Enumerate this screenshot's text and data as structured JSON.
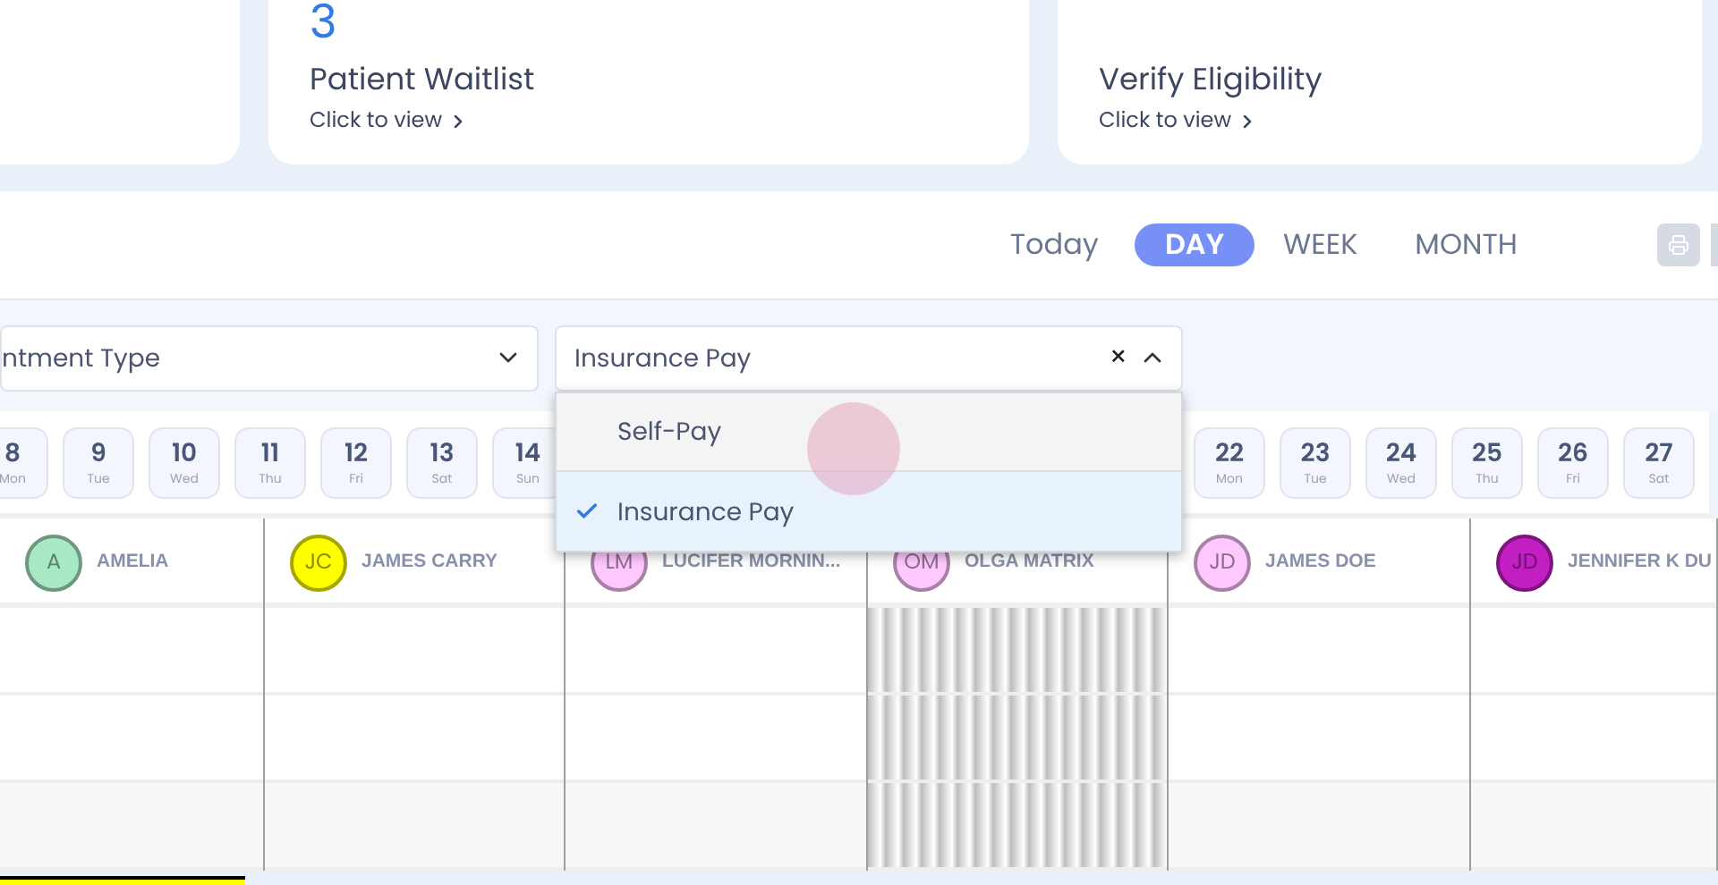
{
  "summary_cards": [
    {
      "count": "3",
      "title": "Patient Waitlist",
      "link": "Click to view"
    },
    {
      "title": "Verify Eligibility",
      "link": "Click to view"
    }
  ],
  "view_tabs": [
    {
      "label": "Today",
      "selected": false,
      "kind": "link"
    },
    {
      "label": "DAY",
      "selected": true,
      "kind": "tab"
    },
    {
      "label": "WEEK",
      "selected": false,
      "kind": "tab"
    },
    {
      "label": "MONTH",
      "selected": false,
      "kind": "tab"
    }
  ],
  "filters": [
    {
      "value": "ntment Type",
      "open": false
    },
    {
      "value": "Insurance Pay",
      "open": true,
      "clear": "×"
    }
  ],
  "dropdown": {
    "options": [
      {
        "label": "Self-Pay",
        "selected": false
      },
      {
        "label": "Insurance Pay",
        "selected": true
      }
    ]
  },
  "days_before": [
    {
      "day": "8",
      "weekday": "Mon"
    },
    {
      "day": "9",
      "weekday": "Tue"
    },
    {
      "day": "10",
      "weekday": "Wed"
    },
    {
      "day": "11",
      "weekday": "Thu"
    },
    {
      "day": "12",
      "weekday": "Fri"
    },
    {
      "day": "13",
      "weekday": "Sat"
    },
    {
      "day": "14",
      "weekday": "Sun"
    }
  ],
  "days_after": [
    {
      "day": "22",
      "weekday": "Mon"
    },
    {
      "day": "23",
      "weekday": "Tue"
    },
    {
      "day": "24",
      "weekday": "Wed"
    },
    {
      "day": "25",
      "weekday": "Thu"
    },
    {
      "day": "26",
      "weekday": "Fri"
    },
    {
      "day": "27",
      "weekday": "Sat"
    }
  ],
  "providers": [
    {
      "initials": "A",
      "name": "AMELIA",
      "color": "#a9e8c4",
      "blocked": false
    },
    {
      "initials": "JC",
      "name": "JAMES CARRY",
      "color": "#ffff00",
      "blocked": false
    },
    {
      "initials": "LM",
      "name": "LUCIFER MORNIN...",
      "color": "#ffc8ff",
      "blocked": false
    },
    {
      "initials": "OM",
      "name": "OLGA MATRIX",
      "color": "#ffc8ff",
      "blocked": true
    },
    {
      "initials": "JD",
      "name": "JAMES DOE",
      "color": "#ffc8ff",
      "blocked": false
    },
    {
      "initials": "JD",
      "name": "JENNIFER K DU",
      "color": "#c21fc2",
      "blocked": false
    }
  ]
}
